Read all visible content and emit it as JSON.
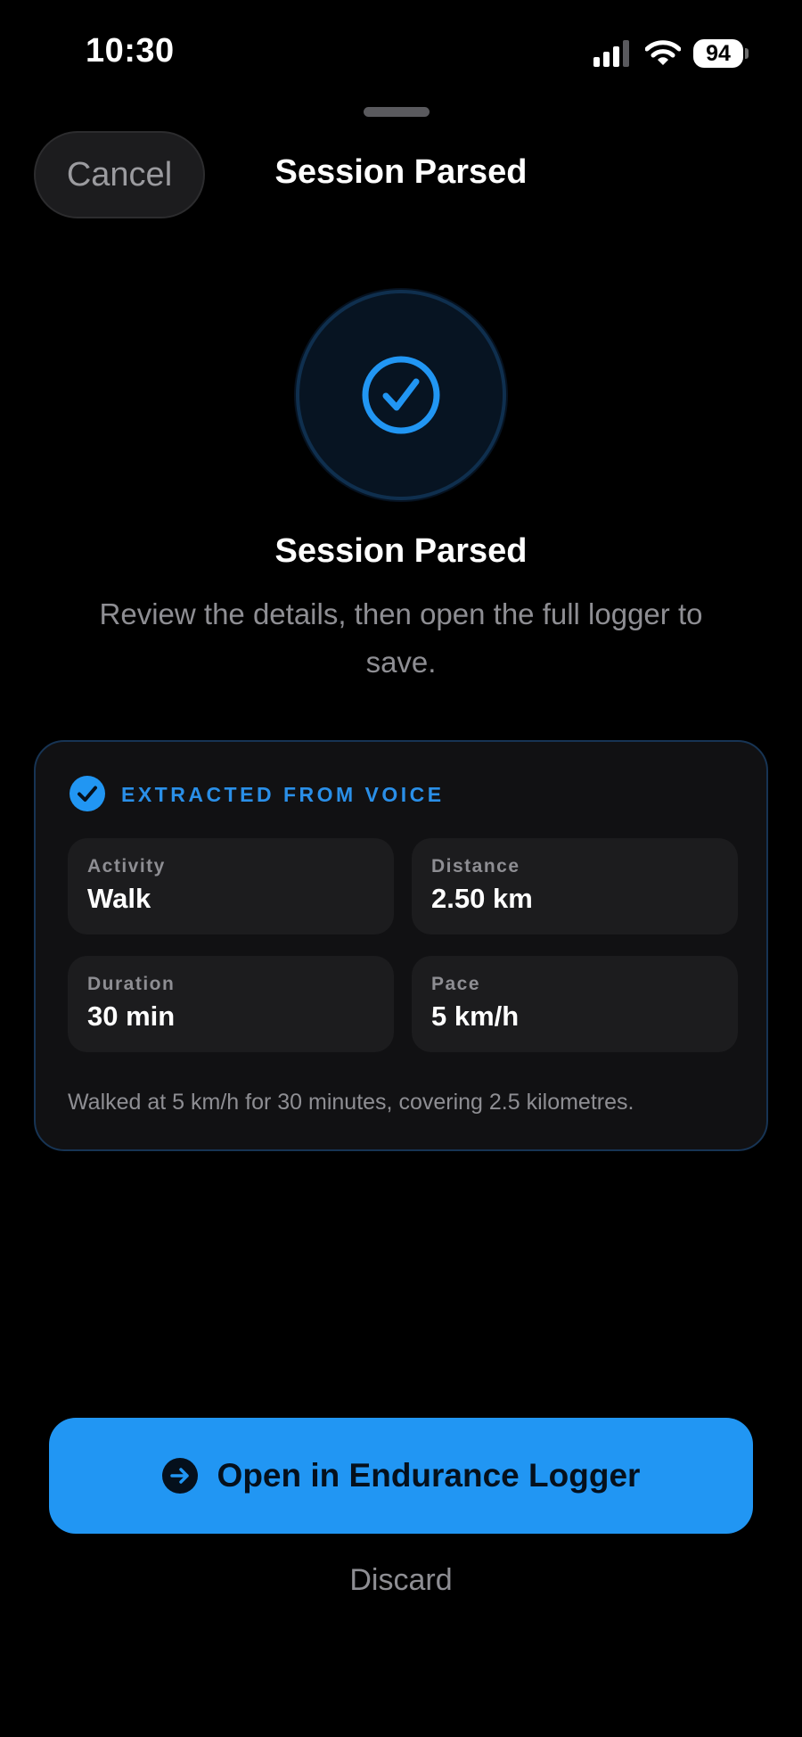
{
  "status_bar": {
    "time": "10:30",
    "battery": "94",
    "icons": [
      "cellular-signal-icon",
      "wifi-icon",
      "battery-icon"
    ]
  },
  "header": {
    "cancel_label": "Cancel",
    "title": "Session Parsed"
  },
  "hero": {
    "icon": "checkmark-circle-icon",
    "title": "Session Parsed",
    "subtitle": "Review the details, then open the full logger to save."
  },
  "card": {
    "heading": "EXTRACTED FROM VOICE",
    "fields": [
      {
        "label": "Activity",
        "value": "Walk"
      },
      {
        "label": "Distance",
        "value": "2.50 km"
      },
      {
        "label": "Duration",
        "value": "30 min"
      },
      {
        "label": "Pace",
        "value": "5 km/h"
      }
    ],
    "summary": "Walked at 5 km/h for 30 minutes, covering 2.5 kilometres."
  },
  "actions": {
    "primary_label": "Open in Endurance Logger",
    "primary_icon": "arrow-right-circle-icon",
    "secondary_label": "Discard"
  },
  "colors": {
    "accent": "#2196f3",
    "heading_blue": "#2a8fe8",
    "background": "#000000",
    "card_background": "#111113",
    "muted_text": "#8e8e93"
  }
}
